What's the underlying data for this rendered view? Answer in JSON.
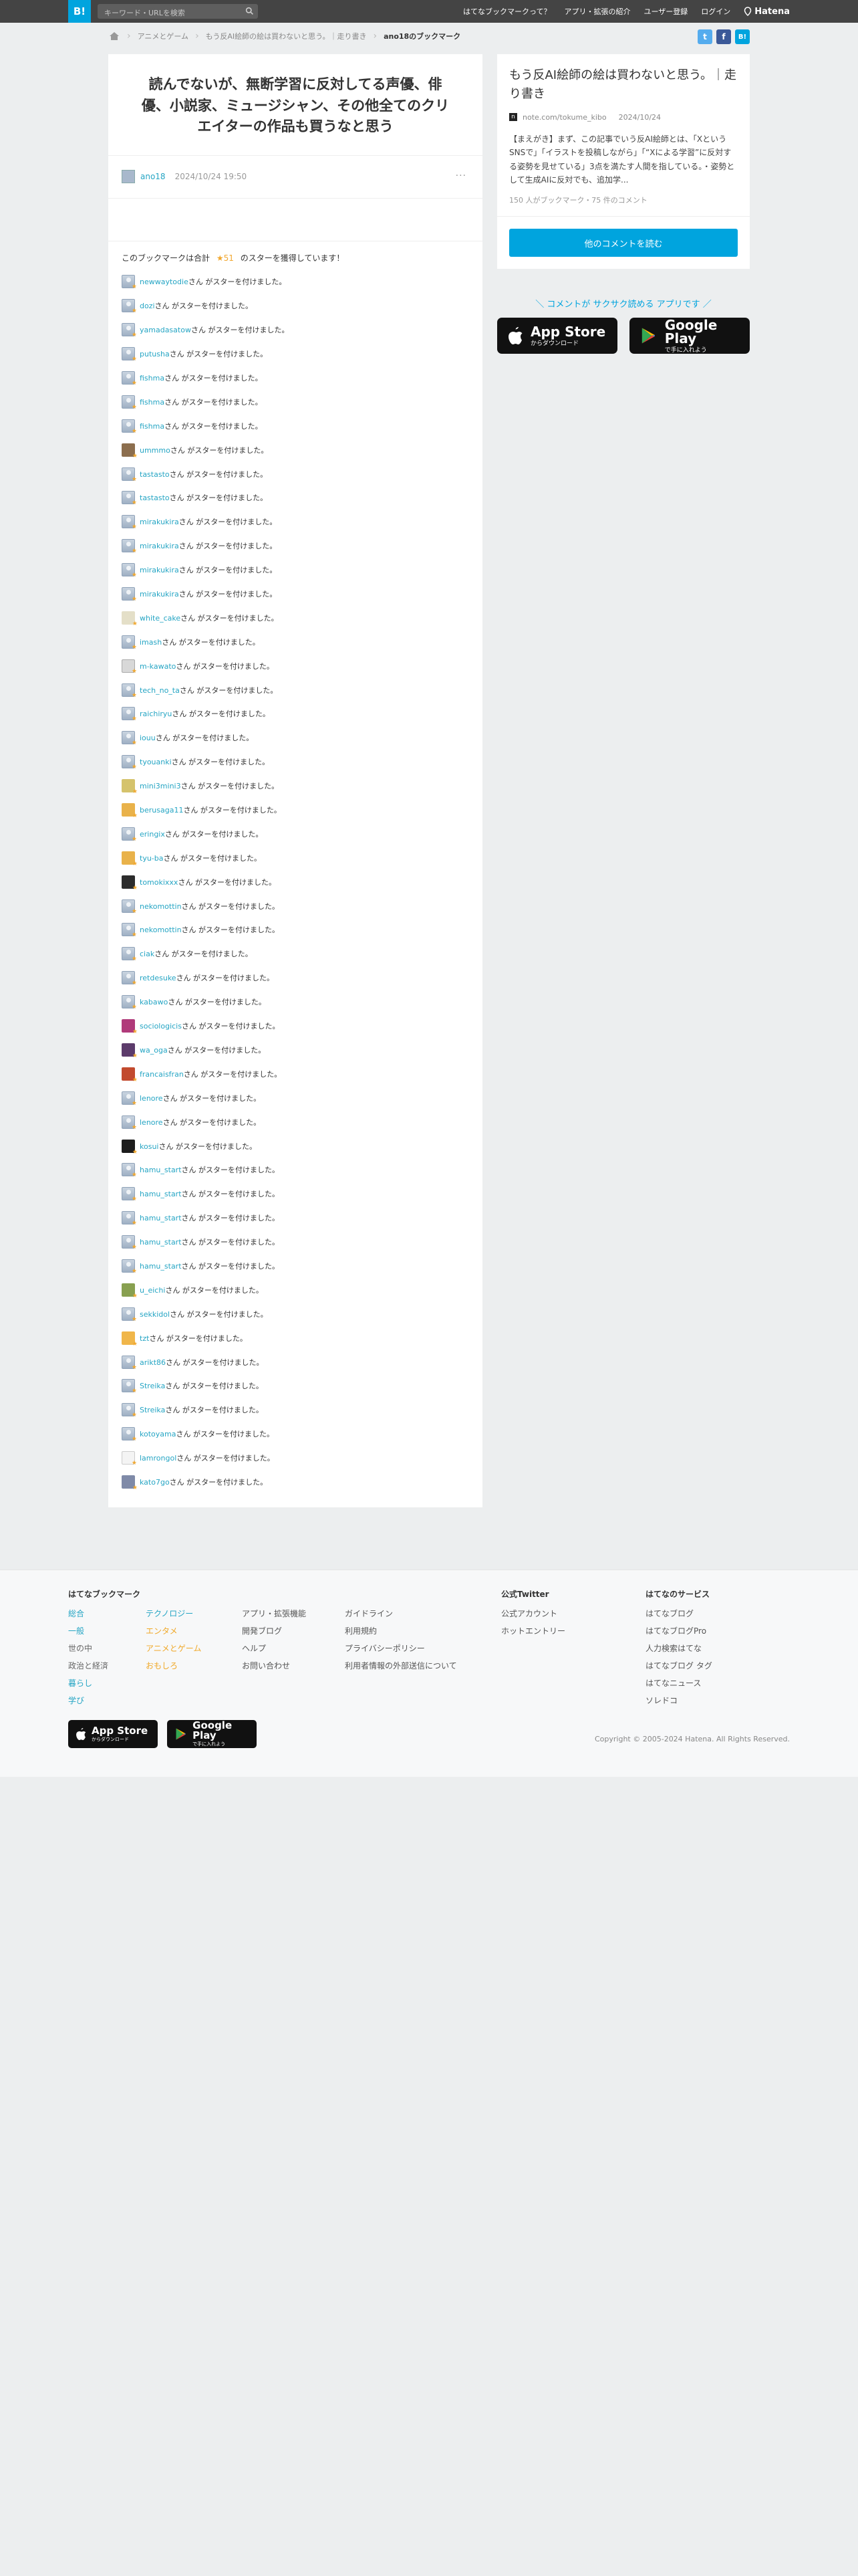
{
  "header": {
    "logo": "B!",
    "search_placeholder": "キーワード・URLを検索",
    "nav": [
      "はてなブックマークって？",
      "アプリ・拡張の紹介",
      "ユーザー登録",
      "ログイン"
    ],
    "hatena": "Hatena"
  },
  "breadcrumb": {
    "category": "アニメとゲーム",
    "entry": "もう反AI絵師の絵は買わないと思う。｜走り書き",
    "current": "ano18のブックマーク"
  },
  "share": {
    "twitter": "t",
    "facebook": "f",
    "hatebu": "B!"
  },
  "bookmark": {
    "comment": "読んでないが、無断学習に反対してる声優、俳優、小説家、ミュージシャン、その他全てのクリエイターの作品も買うなと思う",
    "user": "ano18",
    "date": "2024/10/24 19:50",
    "menu": "···"
  },
  "stars": {
    "prefix": "このブックマークは合計",
    "count": "★51",
    "suffix": "のスターを獲得しています！",
    "row_suffix": "さん がスターを付けました。",
    "users": [
      {
        "name": "newwaytodie",
        "av": "gray"
      },
      {
        "name": "dozi",
        "av": "gray"
      },
      {
        "name": "yamadasatow",
        "av": "gray"
      },
      {
        "name": "putusha",
        "av": "gray"
      },
      {
        "name": "fishma",
        "av": "gray"
      },
      {
        "name": "fishma",
        "av": "gray"
      },
      {
        "name": "fishma",
        "av": "gray"
      },
      {
        "name": "ummmo",
        "av": "c1"
      },
      {
        "name": "tastasto",
        "av": "gray"
      },
      {
        "name": "tastasto",
        "av": "gray"
      },
      {
        "name": "mirakukira",
        "av": "gray"
      },
      {
        "name": "mirakukira",
        "av": "gray"
      },
      {
        "name": "mirakukira",
        "av": "gray"
      },
      {
        "name": "mirakukira",
        "av": "gray"
      },
      {
        "name": "white_cake",
        "av": "c2"
      },
      {
        "name": "imash",
        "av": "gray"
      },
      {
        "name": "m-kawato",
        "av": "c3"
      },
      {
        "name": "tech_no_ta",
        "av": "gray"
      },
      {
        "name": "raichiryu",
        "av": "gray"
      },
      {
        "name": "iouu",
        "av": "gray"
      },
      {
        "name": "tyouanki",
        "av": "gray"
      },
      {
        "name": "mini3mini3",
        "av": "c4"
      },
      {
        "name": "berusaga11",
        "av": "c5"
      },
      {
        "name": "eringix",
        "av": "gray"
      },
      {
        "name": "tyu-ba",
        "av": "c5"
      },
      {
        "name": "tomokixxx",
        "av": "c6"
      },
      {
        "name": "nekomottin",
        "av": "gray"
      },
      {
        "name": "nekomottin",
        "av": "gray"
      },
      {
        "name": "ciak",
        "av": "gray"
      },
      {
        "name": "retdesuke",
        "av": "gray"
      },
      {
        "name": "kabawo",
        "av": "gray"
      },
      {
        "name": "sociologicis",
        "av": "c7"
      },
      {
        "name": "wa_oga",
        "av": "c8"
      },
      {
        "name": "francaisfran",
        "av": "c9"
      },
      {
        "name": "lenore",
        "av": "gray"
      },
      {
        "name": "lenore",
        "av": "gray"
      },
      {
        "name": "kosui",
        "av": "c10"
      },
      {
        "name": "hamu_start",
        "av": "gray"
      },
      {
        "name": "hamu_start",
        "av": "gray"
      },
      {
        "name": "hamu_start",
        "av": "gray"
      },
      {
        "name": "hamu_start",
        "av": "gray"
      },
      {
        "name": "hamu_start",
        "av": "gray"
      },
      {
        "name": "u_eichi",
        "av": "c11"
      },
      {
        "name": "sekkidol",
        "av": "gray"
      },
      {
        "name": "tzt",
        "av": "c12"
      },
      {
        "name": "arikt86",
        "av": "gray"
      },
      {
        "name": "Streika",
        "av": "gray"
      },
      {
        "name": "Streika",
        "av": "gray"
      },
      {
        "name": "kotoyama",
        "av": "gray"
      },
      {
        "name": "lamrongol",
        "av": "c13"
      },
      {
        "name": "kato7go",
        "av": "c14"
      }
    ]
  },
  "entry": {
    "title": "もう反AI絵師の絵は買わないと思う。｜走り書き",
    "favicon": "n",
    "domain": "note.com/tokume_kibo",
    "date": "2024/10/24",
    "description": "【まえがき】まず、この記事でいう反AI絵師とは、「Xという SNSで」「イラストを投稿しながら」「“Xによる学習”に反対する姿勢を見せている」3点を満たす人間を指している。・姿勢として生成AIに反対でも、追加学...",
    "counts": "150 人がブックマーク・75 件のコメント",
    "button": "他のコメントを読む"
  },
  "promo": {
    "text": "＼ コメントが サクサク読める アプリです ／",
    "appstore_big": "App Store",
    "appstore_small": "からダウンロード",
    "googleplay_big": "Google Play",
    "googleplay_small": "で手に入れよう"
  },
  "footer": {
    "col1": {
      "title": "はてなブックマーク",
      "links": [
        "総合",
        "一般",
        "世の中",
        "政治と経済",
        "暮らし",
        "学び"
      ]
    },
    "col2": {
      "links": [
        "テクノロジー",
        "エンタメ",
        "アニメとゲーム",
        "おもしろ"
      ]
    },
    "col3": {
      "links": [
        "アプリ・拡張機能",
        "開発ブログ",
        "ヘルプ",
        "お問い合わせ"
      ]
    },
    "col4": {
      "links": [
        "ガイドライン",
        "利用規約",
        "プライバシーポリシー",
        "利用者情報の外部送信について"
      ]
    },
    "col5": {
      "title": "公式Twitter",
      "links": [
        "公式アカウント",
        "ホットエントリー"
      ]
    },
    "col6": {
      "title": "はてなのサービス",
      "links": [
        "はてなブログ",
        "はてなブログPro",
        "人力検索はてな",
        "はてなブログ タグ",
        "はてなニュース",
        "ソレドコ"
      ]
    },
    "copyright": "Copyright © 2005-2024 Hatena. All Rights Reserved."
  }
}
